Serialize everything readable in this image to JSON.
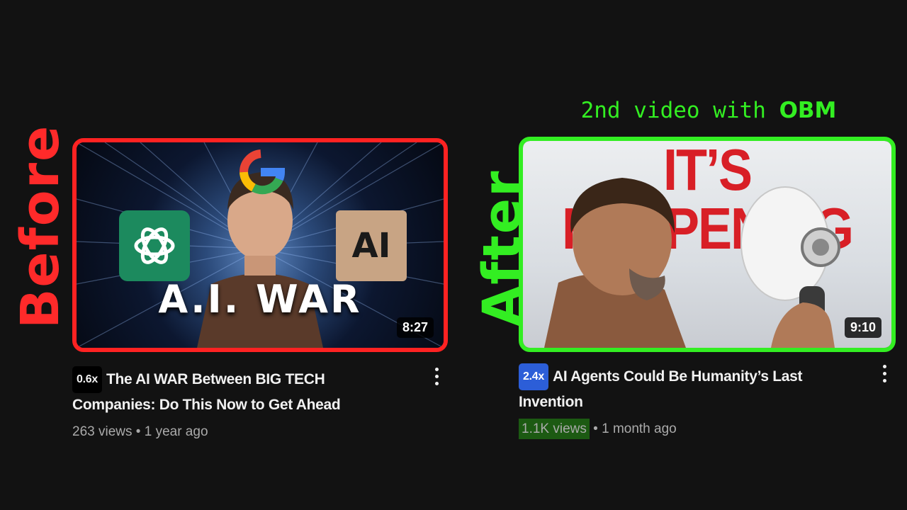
{
  "labels": {
    "before": "Before",
    "after": "After"
  },
  "caption": {
    "prefix": "2nd video with ",
    "highlight": "OBM"
  },
  "before_card": {
    "thumb_title": "A.I. WAR",
    "logos": {
      "left": "openai-logo-icon",
      "right": "anthropic-logo-icon",
      "top": "google-logo-icon"
    },
    "right_logo_text": "AI",
    "duration": "8:27",
    "speed": "0.6x",
    "title": "The AI WAR Between BIG TECH Companies: Do This Now to Get Ahead",
    "views": "263 views",
    "separator": "•",
    "age": "1 year ago"
  },
  "after_card": {
    "thumb_title": "IT’S HAPPENING",
    "duration": "9:10",
    "speed": "2.4x",
    "title": "AI Agents Could Be Humanity’s Last Invention",
    "views": "1.1K views",
    "separator": "•",
    "age": "1 month ago"
  },
  "colors": {
    "before": "#ff2222",
    "after": "#33ee22",
    "badge_blue": "#2c5ed8"
  }
}
